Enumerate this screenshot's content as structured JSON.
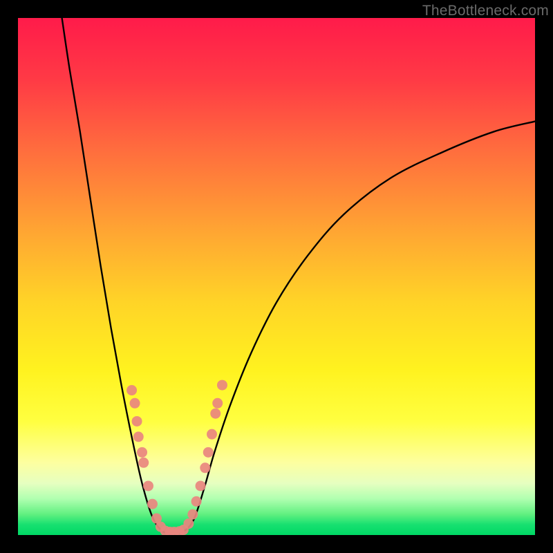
{
  "watermark": "TheBottleneck.com",
  "chart_data": {
    "type": "line",
    "title": "",
    "xlabel": "",
    "ylabel": "",
    "xlim": [
      0,
      100
    ],
    "ylim": [
      0,
      100
    ],
    "grid": false,
    "note": "No axis ticks or numeric labels are rendered; values are positional estimates in percent of plot area (0 = left/bottom, 100 = right/top).",
    "series": [
      {
        "name": "bottleneck-curve",
        "points": [
          {
            "x": 8.5,
            "y": 100
          },
          {
            "x": 10,
            "y": 90
          },
          {
            "x": 12,
            "y": 78
          },
          {
            "x": 14,
            "y": 65
          },
          {
            "x": 16,
            "y": 52
          },
          {
            "x": 18,
            "y": 40
          },
          {
            "x": 20,
            "y": 29
          },
          {
            "x": 22,
            "y": 19
          },
          {
            "x": 24,
            "y": 10
          },
          {
            "x": 26,
            "y": 3.5
          },
          {
            "x": 28,
            "y": 0.7
          },
          {
            "x": 30,
            "y": 0.6
          },
          {
            "x": 32,
            "y": 0.7
          },
          {
            "x": 34,
            "y": 3
          },
          {
            "x": 36,
            "y": 9
          },
          {
            "x": 38,
            "y": 16
          },
          {
            "x": 41,
            "y": 25
          },
          {
            "x": 45,
            "y": 35
          },
          {
            "x": 50,
            "y": 45
          },
          {
            "x": 56,
            "y": 54
          },
          {
            "x": 63,
            "y": 62
          },
          {
            "x": 72,
            "y": 69
          },
          {
            "x": 82,
            "y": 74
          },
          {
            "x": 92,
            "y": 78
          },
          {
            "x": 100,
            "y": 80
          }
        ]
      }
    ],
    "markers": {
      "name": "highlighted-points",
      "color": "#e9857f",
      "points": [
        {
          "x": 22.0,
          "y": 28.0
        },
        {
          "x": 22.6,
          "y": 25.5
        },
        {
          "x": 23.0,
          "y": 22.0
        },
        {
          "x": 23.3,
          "y": 19.0
        },
        {
          "x": 24.0,
          "y": 16.0
        },
        {
          "x": 24.3,
          "y": 14.0
        },
        {
          "x": 25.2,
          "y": 9.5
        },
        {
          "x": 26.0,
          "y": 6.0
        },
        {
          "x": 26.8,
          "y": 3.2
        },
        {
          "x": 27.6,
          "y": 1.6
        },
        {
          "x": 28.5,
          "y": 0.8
        },
        {
          "x": 29.4,
          "y": 0.6
        },
        {
          "x": 30.2,
          "y": 0.6
        },
        {
          "x": 31.2,
          "y": 0.7
        },
        {
          "x": 32.0,
          "y": 1.0
        },
        {
          "x": 33.0,
          "y": 2.2
        },
        {
          "x": 33.8,
          "y": 4.0
        },
        {
          "x": 34.5,
          "y": 6.5
        },
        {
          "x": 35.3,
          "y": 9.5
        },
        {
          "x": 36.2,
          "y": 13.0
        },
        {
          "x": 36.8,
          "y": 16.0
        },
        {
          "x": 37.5,
          "y": 19.5
        },
        {
          "x": 38.2,
          "y": 23.5
        },
        {
          "x": 38.6,
          "y": 25.5
        },
        {
          "x": 39.5,
          "y": 29.0
        }
      ]
    }
  }
}
